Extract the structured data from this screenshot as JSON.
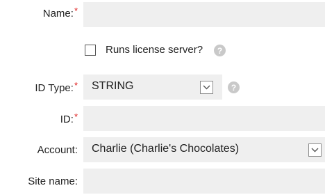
{
  "form": {
    "name": {
      "label": "Name:",
      "required_mark": "*",
      "value": ""
    },
    "license_server": {
      "label": "Runs license server?",
      "checked": false,
      "help_icon": "help-icon"
    },
    "id_type": {
      "label": "ID Type:",
      "required_mark": "*",
      "value": "STRING",
      "help_icon": "help-icon"
    },
    "id": {
      "label": "ID:",
      "required_mark": "*",
      "value": ""
    },
    "account": {
      "label": "Account:",
      "value": "Charlie (Charlie's Chocolates)"
    },
    "site_name": {
      "label": "Site name:",
      "value": ""
    }
  },
  "colors": {
    "required": "#e02020",
    "field_bg": "#efefef",
    "help_bg": "#c9c9c9"
  }
}
